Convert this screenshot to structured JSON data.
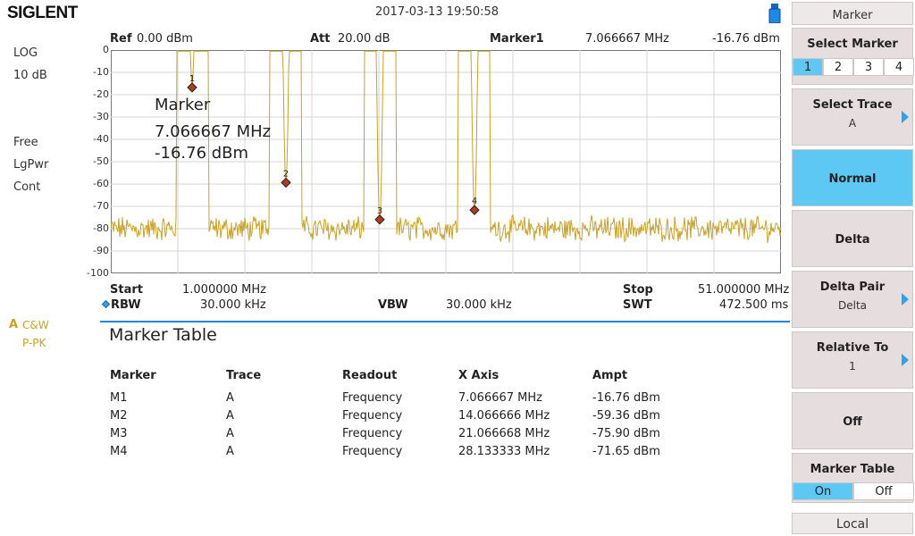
{
  "header": {
    "brand": "SIGLENT",
    "datetime": "2017-03-13   19:50:58"
  },
  "left": {
    "scale_type": "LOG",
    "scale_div": "10 dB",
    "trig": "Free",
    "avg_type": "LgPwr",
    "sweep": "Cont",
    "trace_letter": "A",
    "trace_mode": "C&W",
    "detector": "P-PK"
  },
  "top_info": {
    "ref_label": "Ref",
    "ref_value": "0.00 dBm",
    "att_label": "Att",
    "att_value": "20.00 dB",
    "marker_label": "Marker1",
    "marker_freq": "7.066667 MHz",
    "marker_ampt": "-16.76 dBm"
  },
  "plot": {
    "y_ticks": [
      "0",
      "-10",
      "-20",
      "-30",
      "-40",
      "-50",
      "-60",
      "-70",
      "-80",
      "-90",
      "-100"
    ],
    "marker_readout_title": "Marker",
    "marker_readout_freq": "7.066667 MHz",
    "marker_readout_ampt": "-16.76 dBm",
    "trace_color": "#c9a227",
    "marker_color": "#b5381f",
    "noise_floor_dbm": -80,
    "markers": [
      {
        "label": "1",
        "freq_mhz": 7.066667,
        "ampt_dbm": -16.76
      },
      {
        "label": "2",
        "freq_mhz": 14.066666,
        "ampt_dbm": -59.36
      },
      {
        "label": "3",
        "freq_mhz": 21.066668,
        "ampt_dbm": -75.9
      },
      {
        "label": "4",
        "freq_mhz": 28.133333,
        "ampt_dbm": -71.65
      }
    ],
    "x_range_mhz": [
      1,
      51
    ],
    "y_range_dbm": [
      -100,
      0
    ]
  },
  "bottom_info": {
    "start_label": "Start",
    "start_value": "1.000000 MHz",
    "stop_label": "Stop",
    "stop_value": "51.000000 MHz",
    "rbw_label": "RBW",
    "rbw_value": "30.000 kHz",
    "vbw_label": "VBW",
    "vbw_value": "30.000 kHz",
    "swt_label": "SWT",
    "swt_value": "472.500 ms"
  },
  "marker_table": {
    "title": "Marker Table",
    "columns": [
      "Marker",
      "Trace",
      "Readout",
      "X Axis",
      "Ampt"
    ],
    "rows": [
      [
        "M1",
        "A",
        "Frequency",
        "7.066667 MHz",
        "-16.76 dBm"
      ],
      [
        "M2",
        "A",
        "Frequency",
        "14.066666 MHz",
        "-59.36 dBm"
      ],
      [
        "M3",
        "A",
        "Frequency",
        "21.066668 MHz",
        "-75.90 dBm"
      ],
      [
        "M4",
        "A",
        "Frequency",
        "28.133333 MHz",
        "-71.65 dBm"
      ]
    ]
  },
  "menu": {
    "title": "Marker",
    "select_marker": {
      "label": "Select Marker",
      "options": [
        "1",
        "2",
        "3",
        "4"
      ],
      "selected": "1"
    },
    "select_trace": {
      "label": "Select Trace",
      "value": "A"
    },
    "normal": {
      "label": "Normal"
    },
    "delta": {
      "label": "Delta"
    },
    "delta_pair": {
      "label": "Delta Pair",
      "value": "Delta"
    },
    "relative_to": {
      "label": "Relative To",
      "value": "1"
    },
    "off": {
      "label": "Off"
    },
    "marker_table": {
      "label": "Marker Table",
      "on": "On",
      "off": "Off"
    },
    "local": "Local",
    "accent_color": "#5ec8f5"
  }
}
